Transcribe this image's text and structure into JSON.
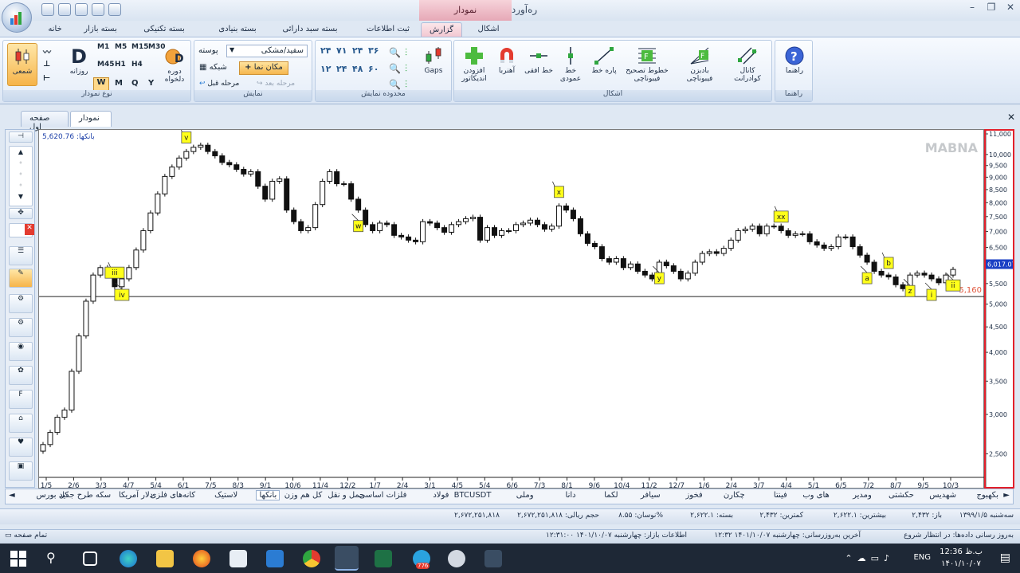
{
  "window": {
    "title": "ره‌آورد نوین ۳",
    "contextual_tab_header": "نمودار",
    "controls": [
      "–",
      "❐",
      "✕"
    ]
  },
  "ribbon_tabs": [
    "خانه",
    "بسته بازار",
    "بسته تکنیکی",
    "بسته بنیادی",
    "بسته سبد دارائی",
    "ثبت اطلاعات",
    "گزارش",
    "اشکال"
  ],
  "ribbon": {
    "chart_type_group": {
      "label": "نوع نمودار",
      "candle_label": "شمعی",
      "daily_label": "روزانه",
      "daily_glyph": "D",
      "custom_period_label": "دوره دلخواه",
      "periods": [
        "M1",
        "M5",
        "M15",
        "M30",
        "M45",
        "H1",
        "H4",
        "W",
        "M",
        "Q",
        "Y"
      ]
    },
    "display_group": {
      "label": "نمایش",
      "skin_label": "پوسته",
      "skin_value": "سفید/مشکی",
      "grid_label": "شبکه",
      "cursor_label": "مکان نما",
      "prev_step_label": "مرحله قبل",
      "next_step_label": "مرحله بعد"
    },
    "range_group": {
      "label": "محدوده نمایش",
      "digits": [
        "۲۴",
        "۷۱",
        "۲۴",
        "۳۶",
        "۱۲",
        "۲۴",
        "۴۸",
        "۶۰"
      ]
    },
    "gaps_label": "Gaps",
    "shapes_group": {
      "label": "اشکال",
      "buttons": [
        "افزودن اندیکاتور",
        "آهنربا",
        "خط افقی",
        "خط عمودی",
        "پاره خط",
        "خطوط تصحیح فیبوناچی",
        "بادبزن فیبوناچی",
        "کانال کوادرانت"
      ]
    },
    "help_group": {
      "label": "راهنما",
      "button": "راهنما"
    }
  },
  "page_tabs": [
    "نمودار",
    "صفحه اول"
  ],
  "chart": {
    "watermark": "MABNA",
    "top_label": "بانکها: 5,620.76",
    "hline_label": "5,160",
    "last_price_label": "6,017.07",
    "y_ticks": [
      "11,000",
      "10,000",
      "9,500",
      "9,000",
      "8,500",
      "8,000",
      "7,500",
      "7,000",
      "6,500",
      "6,000",
      "5,500",
      "5,000",
      "4,500",
      "4,000",
      "3,500",
      "3,000",
      "2,500"
    ],
    "x_ticks": [
      "1/5",
      "2/6",
      "3/3",
      "4/7",
      "5/4",
      "6/1",
      "7/5",
      "8/3",
      "9/1",
      "10/6",
      "11/4",
      "12/2",
      "1/7",
      "2/4",
      "3/1",
      "4/5",
      "5/4",
      "6/6",
      "7/3",
      "8/1",
      "9/6",
      "10/4",
      "11/2",
      "12/7",
      "1/6",
      "2/4",
      "3/7",
      "4/4",
      "5/1",
      "6/5",
      "7/2",
      "8/7",
      "9/5",
      "10/3"
    ],
    "wave_labels": [
      "iii",
      "iv",
      "v",
      "w",
      "x",
      "y",
      "xx",
      "a",
      "b",
      "z",
      "i",
      "ii"
    ]
  },
  "chart_data": {
    "type": "candlestick",
    "title": "",
    "series": [
      {
        "values": [
          2600,
          2750,
          2950,
          3050,
          3650,
          4300,
          5050,
          5700,
          5900,
          5700,
          5400,
          5600,
          5900,
          6400,
          7000,
          7600,
          8300,
          9000,
          9400,
          9800,
          10100,
          10300,
          10400,
          10100,
          9900,
          9600,
          9500,
          9300,
          9100,
          9200,
          8600,
          8100,
          8800,
          8900,
          7700,
          7300,
          7000,
          7100,
          7900,
          8800,
          9200,
          8700,
          8700,
          8100,
          7700,
          7200,
          7000,
          7250,
          7200,
          6850,
          6800,
          6700,
          6650,
          7300,
          7250,
          7100,
          6950,
          7200,
          7300,
          7400,
          7450,
          6700,
          7100,
          6850,
          7000,
          7000,
          7200,
          7250,
          7350,
          7200,
          7050,
          7150,
          7850,
          7700,
          7400,
          6900,
          6600,
          6500,
          6150,
          6050,
          6150,
          5900,
          6000,
          5800,
          5700,
          5600,
          6050,
          5950,
          5800,
          5600,
          5750,
          6050,
          6300,
          6350,
          6300,
          6450,
          6700,
          7000,
          7050,
          7150,
          6900,
          7150,
          7150,
          7000,
          6850,
          6900,
          6900,
          6650,
          6550,
          6450,
          6500,
          6800,
          6800,
          6500,
          6250,
          6050,
          5800,
          5700,
          5650,
          5450,
          5350,
          5700,
          5750,
          5700,
          5600,
          5500,
          5700,
          5850
        ]
      }
    ],
    "y_axis": {
      "min": 2250,
      "max": 11000,
      "ticks": [
        2500,
        3000,
        3500,
        4000,
        4500,
        5000,
        5500,
        6000,
        6500,
        7000,
        7500,
        8000,
        8500,
        9000,
        9500,
        10000,
        11000
      ]
    },
    "horizontal_line": 5160,
    "last_price": 6017.07
  },
  "ticker_tabs": [
    "بکهبوج",
    "شهدیس",
    "حکشتی",
    "ومدیر",
    "های وب",
    "فینتا",
    "چکارن",
    "فخوز",
    "سیافر",
    "لکما",
    "دانا",
    "وملی",
    "BTCUSDT",
    "فولاد",
    "فلزات اساسی",
    "حمل و نقل",
    "کل هم وزن",
    "بانکها",
    "لاستیک",
    "کانه‌های فلزی",
    "دلار آمریکا",
    "سکه طرح جدید",
    "کل بورس"
  ],
  "active_ticker": "بانکها",
  "status": {
    "date": "سه‌شنبه ۱۳۹۹/۱/۵",
    "open": "باز: ۲,۴۳۲",
    "high": "بیشترین: ۲,۶۲۲.۱",
    "low": "کمترین: ۲,۴۳۲",
    "close": "بسته: ۲,۶۲۲.۱",
    "fluct": "نوسان: ۸.۵۵%",
    "volume": "حجم ریالی: ۲,۶۷۲,۲۵۱,۸۱۸",
    "volume2": "۲,۶۷۲,۲۵۱,۸۱۸"
  },
  "status2": {
    "update_status": "به‌روز رسانی داده‌ها: در انتظار شروع",
    "last_update": "آخرین به‌روزرسانی: چهارشنبه ۱۴۰۱/۱۰/۰۷ ۱۲:۳۲",
    "market_info": "اطلاعات بازار: چهارشنبه ۱۴۰۱/۱۰/۰۷ ۱۲:۳۱:۰۰",
    "fullscreen": "تمام صفحه"
  },
  "taskbar": {
    "time": "12:36 ب.ظ",
    "date": "۱۴۰۱/۱۰/۰۷",
    "lang": "ENG",
    "badge": "776"
  }
}
